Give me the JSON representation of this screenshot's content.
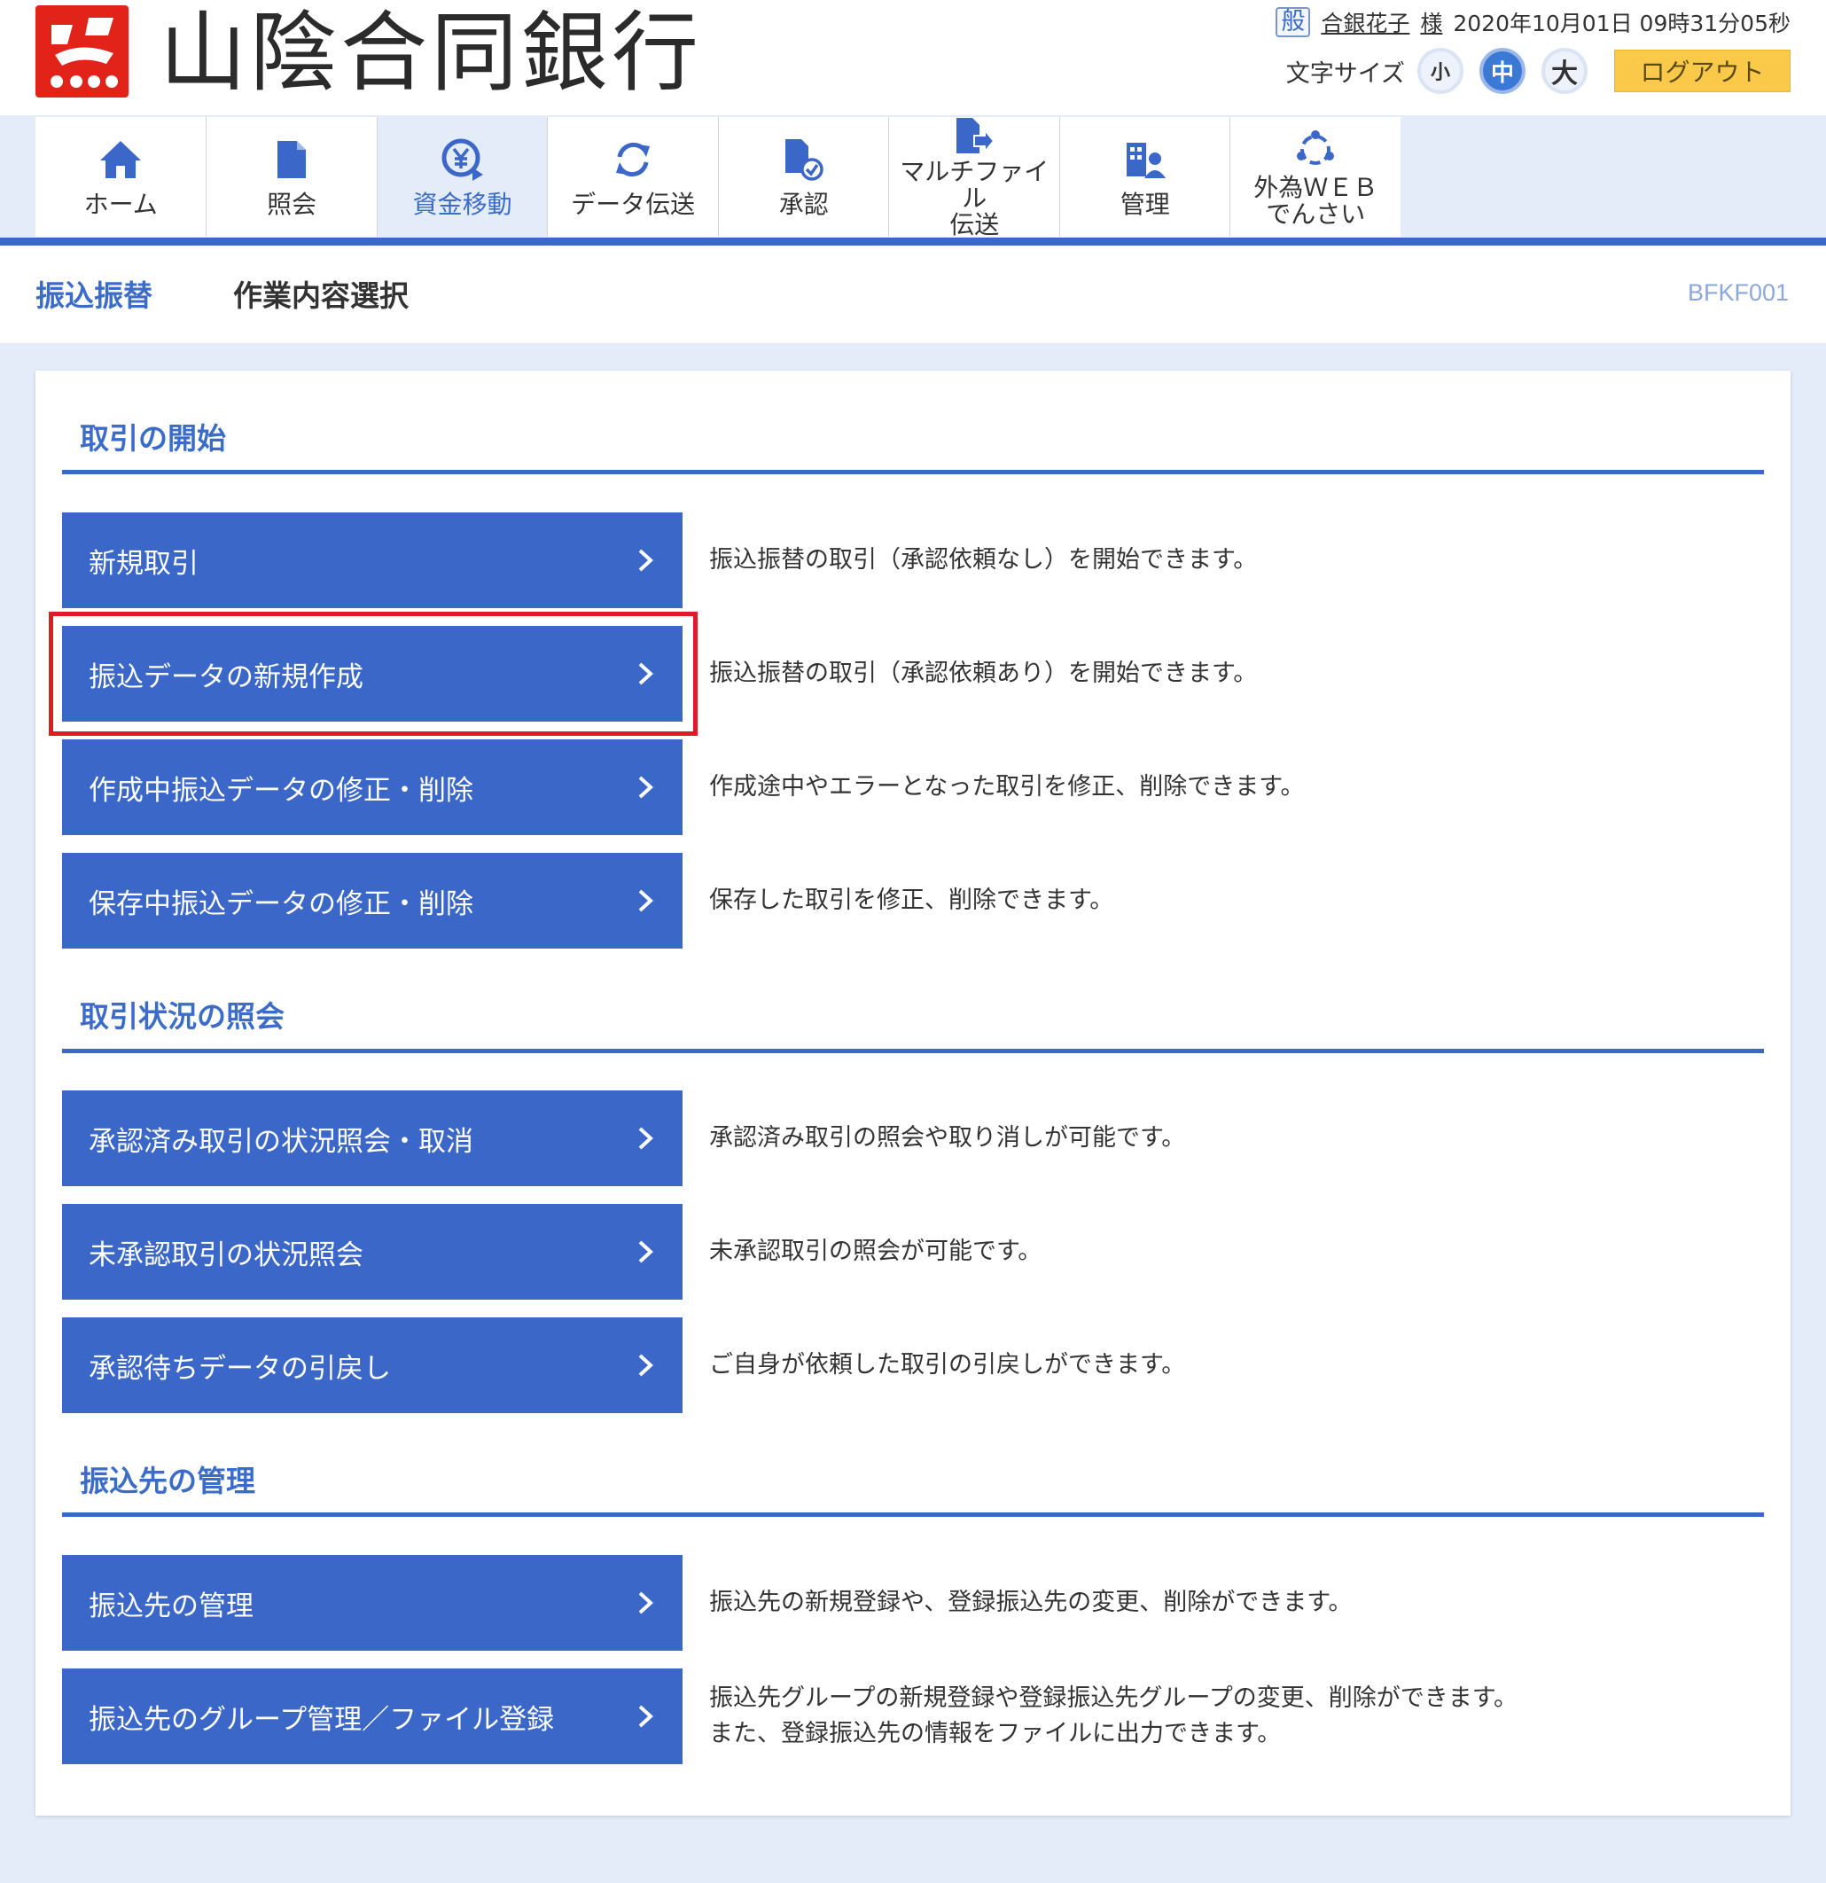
{
  "header": {
    "bank_name": "山陰合同銀行",
    "role_badge": "般",
    "user_name": "合銀花子",
    "honorific": "様",
    "datetime": "2020年10月01日 09時31分05秒",
    "font_size_label": "文字サイズ",
    "font_sizes": [
      "小",
      "中",
      "大"
    ],
    "logout_label": "ログアウト"
  },
  "nav": {
    "items": [
      {
        "label": "ホーム",
        "icon": "home-icon"
      },
      {
        "label": "照会",
        "icon": "document-icon"
      },
      {
        "label": "資金移動",
        "icon": "yen-transfer-icon"
      },
      {
        "label": "データ伝送",
        "icon": "sync-icon"
      },
      {
        "label": "承認",
        "icon": "approve-icon"
      },
      {
        "label_line1": "マルチファイル",
        "label_line2": "伝送",
        "icon": "file-send-icon"
      },
      {
        "label": "管理",
        "icon": "management-icon"
      },
      {
        "label_line1": "外為ＷＥＢ",
        "label_line2": "でんさい",
        "icon": "forex-icon"
      }
    ],
    "active_index": 2
  },
  "title": {
    "main": "振込振替",
    "sub": "作業内容選択",
    "screen_id": "BFKF001"
  },
  "sections": [
    {
      "title": "取引の開始",
      "items": [
        {
          "label": "新規取引",
          "desc": "振込振替の取引（承認依頼なし）を開始できます。"
        },
        {
          "label": "振込データの新規作成",
          "desc": "振込振替の取引（承認依頼あり）を開始できます。"
        },
        {
          "label": "作成中振込データの修正・削除",
          "desc": "作成途中やエラーとなった取引を修正、削除できます。"
        },
        {
          "label": "保存中振込データの修正・削除",
          "desc": "保存した取引を修正、削除できます。"
        }
      ]
    },
    {
      "title": "取引状況の照会",
      "items": [
        {
          "label": "承認済み取引の状況照会・取消",
          "desc": "承認済み取引の照会や取り消しが可能です。"
        },
        {
          "label": "未承認取引の状況照会",
          "desc": "未承認取引の照会が可能です。"
        },
        {
          "label": "承認待ちデータの引戻し",
          "desc": "ご自身が依頼した取引の引戻しができます。"
        }
      ]
    },
    {
      "title": "振込先の管理",
      "items": [
        {
          "label": "振込先の管理",
          "desc": "振込先の新規登録や、登録振込先の変更、削除ができます。"
        },
        {
          "label": "振込先のグループ管理／ファイル登録",
          "desc_line1": "振込先グループの新規登録や登録振込先グループの変更、削除ができます。",
          "desc_line2": "また、登録振込先の情報をファイルに出力できます。"
        }
      ]
    }
  ],
  "colors": {
    "brand_blue": "#3b68c8",
    "highlight_red": "#e01b24",
    "logo_red": "#e2231a",
    "logout_yellow": "#fbc94a",
    "page_bg": "#e4ecfa"
  }
}
